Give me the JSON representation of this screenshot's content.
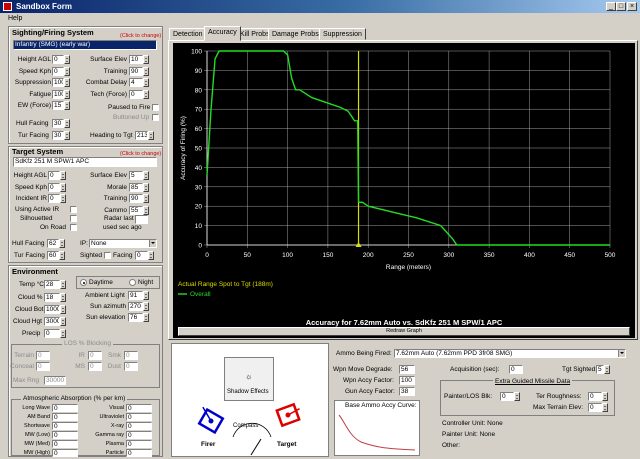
{
  "window": {
    "title": "Sandbox Form",
    "minimize": "_",
    "maximize": "□",
    "close": "×"
  },
  "menu": {
    "help": "Help"
  },
  "sighting": {
    "header": "Sighting/Firing System",
    "change_hint": "(Click to change)",
    "system": "Infantry (SMG) (early war)",
    "left_fields": [
      {
        "label": "Height AGL",
        "value": "0"
      },
      {
        "label": "Speed Kph",
        "value": "0"
      },
      {
        "label": "Suppression",
        "value": "100"
      },
      {
        "label": "Fatigue",
        "value": "100"
      },
      {
        "label": "EW (Force)",
        "value": "15"
      }
    ],
    "right_fields": [
      {
        "label": "Surface Elev",
        "value": "10"
      },
      {
        "label": "Training",
        "value": "90"
      },
      {
        "label": "Combat Delay",
        "value": "4"
      },
      {
        "label": "Tech (Force)",
        "value": "0"
      }
    ],
    "paused_label": "Paused to Fire",
    "buttoned_label": "Buttoned Up",
    "hull_label": "Hull Facing",
    "hull_value": "30",
    "tur_label": "Tur Facing",
    "tur_value": "30",
    "heading_label": "Heading to Tgt",
    "heading_value": "213"
  },
  "target": {
    "header": "Target System",
    "change_hint": "(Click to change)",
    "system": "SdKfz 251 M SPW/1 APC",
    "left_fields": [
      {
        "label": "Height AGL",
        "value": "0"
      },
      {
        "label": "Speed Kph",
        "value": "0"
      },
      {
        "label": "Incident IR",
        "value": "0"
      }
    ],
    "right_fields": [
      {
        "label": "Surface Elev",
        "value": "5"
      },
      {
        "label": "Morale",
        "value": "85"
      },
      {
        "label": "Training",
        "value": "90"
      },
      {
        "label": "Cammo",
        "value": "55"
      }
    ],
    "using_ir": "Using Active IR",
    "silhouetted": "Silhouetted",
    "on_road": "On Road",
    "radar_last": "Radar last",
    "used_sec_ago": "used sec ago",
    "hull_label": "Hull Facing",
    "hull_value": "62",
    "tur_label": "Tur Facing",
    "tur_value": "60",
    "ip_label": "IP:",
    "ip_value": "None",
    "sighted_label": "Sighted",
    "facing_label": "Facing",
    "facing_value": "0"
  },
  "environment": {
    "header": "Environment",
    "temp_label": "Temp °C",
    "temp_value": "28",
    "cloud_pct_label": "Cloud %",
    "cloud_pct_value": "18",
    "cloud_bot_label": "Cloud Bot",
    "cloud_bot_value": "1000",
    "cloud_hgt_label": "Cloud Hgt",
    "cloud_hgt_value": "3000",
    "precip_label": "Precip",
    "precip_value": "0",
    "daytime": "Daytime",
    "night": "Night",
    "ambient_label": "Ambient Light",
    "ambient_value": "91",
    "sun_az_label": "Sun azimuth",
    "sun_az_value": "270",
    "sun_el_label": "Sun elevation",
    "sun_el_value": "76",
    "los_header": "LOS % Blocking",
    "los": [
      {
        "label": "Terrain",
        "value": "0"
      },
      {
        "label": "IR",
        "value": "0"
      },
      {
        "label": "Smk",
        "value": "0"
      },
      {
        "label": "Conceal",
        "value": "0"
      },
      {
        "label": "MS",
        "value": "0"
      },
      {
        "label": "Dust",
        "value": "0"
      }
    ],
    "max_rng_label": "Max Rng",
    "max_rng_value": "30000",
    "atmos_header": "Atmospheric Absorption (% per km)",
    "atmos_left": [
      {
        "label": "Long Wave",
        "value": "0"
      },
      {
        "label": "AM Band",
        "value": "0"
      },
      {
        "label": "Shortwave",
        "value": "0"
      },
      {
        "label": "MW (Low)",
        "value": "0"
      },
      {
        "label": "MW (Med)",
        "value": "0"
      },
      {
        "label": "MW (High)",
        "value": "0"
      }
    ],
    "atmos_right": [
      {
        "label": "Visual",
        "value": "0"
      },
      {
        "label": "Ultraviolet",
        "value": "0"
      },
      {
        "label": "X-ray",
        "value": "0"
      },
      {
        "label": "Gamma ray",
        "value": "0"
      },
      {
        "label": "Plasma",
        "value": "0"
      },
      {
        "label": "Particle",
        "value": "0"
      }
    ]
  },
  "tabs": [
    "Detection",
    "Accuracy",
    "Kill Probs",
    "Damage Probs",
    "Suppression"
  ],
  "chart_legend": {
    "spot": "Actual Range Spot to Tgt (188m)",
    "series": "Overall"
  },
  "chart_title": "Accuracy for  7.62mm Auto  vs.  SdKfz 251 M SPW/1 APC",
  "chart_button": "Redraw Graph",
  "chart_data": {
    "type": "line",
    "xlabel": "Range (meters)",
    "ylabel": "Accuracy of Firing (%)",
    "xlim": [
      0,
      500
    ],
    "ylim": [
      0,
      100
    ],
    "xticks": [
      "0",
      "50",
      "100",
      "150",
      "200",
      "250",
      "300",
      "350",
      "400",
      "450",
      "500"
    ],
    "yticks": [
      "0",
      "10",
      "20",
      "30",
      "40",
      "50",
      "60",
      "70",
      "80",
      "90",
      "100"
    ],
    "grid": true,
    "background": "#000000",
    "series": [
      {
        "name": "Overall",
        "color": "#22dd22",
        "x": [
          0,
          5,
          10,
          15,
          95,
          100,
          105,
          110,
          115,
          130,
          165,
          175,
          180,
          183,
          185,
          187,
          188,
          193,
          200,
          230,
          260,
          290,
          305,
          310,
          500
        ],
        "y": [
          36,
          70,
          96,
          100,
          100,
          98,
          86,
          80,
          80,
          76,
          71,
          69,
          66,
          64,
          64,
          64,
          22,
          22,
          20,
          17,
          14,
          10,
          3,
          0,
          0
        ]
      }
    ],
    "marker_x": 188,
    "marker_color": "#dddd00"
  },
  "ammo": {
    "fired_label": "Ammo Being Fired:",
    "fired_value": "7.62mm Auto (7.62mm PPD 3fr08 SMG)",
    "move_label": "Wpn Move Degrade:",
    "move_value": "56",
    "wpn_accy_label": "Wpn Accy Factor:",
    "wpn_accy_value": "100",
    "gun_accy_label": "Gun Accy Factor:",
    "gun_accy_value": "38",
    "base_curve_label": "Base Ammo Accy Curve:",
    "acq_label": "Acquisition (sec):",
    "acq_value": "0",
    "tgt_sighted_label": "Tgt Sighted:",
    "tgt_sighted_value": "5",
    "egm_label": "Extra Guided Missile Data",
    "painter_label": "Painter/LOS Blk:",
    "painter_value": "0",
    "ter_rough_label": "Ter Roughness:",
    "ter_rough_value": "0",
    "max_elev_label": "Max Terrain Elev:",
    "max_elev_value": "0",
    "controller_unit": "Controller Unit: None",
    "painter_unit": "Painter Unit: None",
    "other": "Other:"
  },
  "compass": {
    "shadow": "Shadow Effects",
    "label": "Compass",
    "firer": "Firer",
    "target": "Target"
  }
}
